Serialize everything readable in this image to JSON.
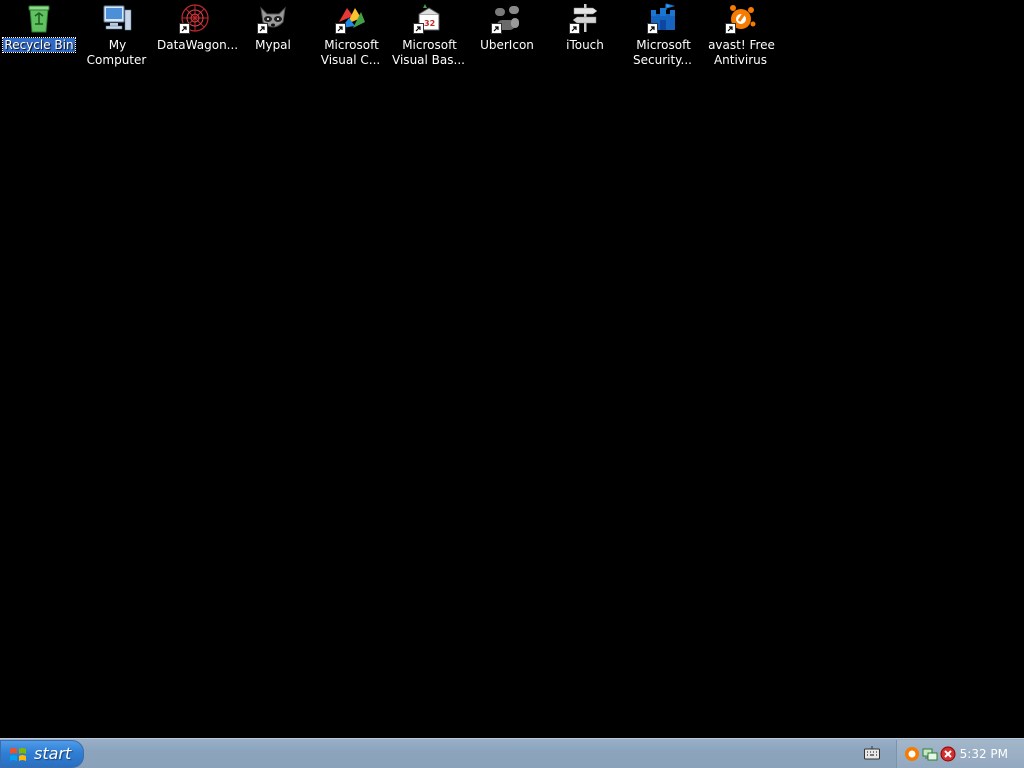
{
  "desktop": {
    "background_color": "#000000",
    "icons": [
      {
        "label": "Recycle Bin",
        "icon": "recycle-bin-icon",
        "selected": true,
        "shortcut": false
      },
      {
        "label": "My Computer",
        "icon": "my-computer-icon",
        "selected": false,
        "shortcut": false
      },
      {
        "label": "DataWagon...",
        "icon": "datawagon-icon",
        "selected": false,
        "shortcut": true
      },
      {
        "label": "Mypal",
        "icon": "mypal-icon",
        "selected": false,
        "shortcut": true
      },
      {
        "label": "Microsoft\nVisual C...",
        "icon": "visual-c-icon",
        "selected": false,
        "shortcut": true
      },
      {
        "label": "Microsoft\nVisual Bas...",
        "icon": "visual-basic-icon",
        "selected": false,
        "shortcut": true
      },
      {
        "label": "UberIcon",
        "icon": "ubericon-icon",
        "selected": false,
        "shortcut": true
      },
      {
        "label": "iTouch",
        "icon": "itouch-icon",
        "selected": false,
        "shortcut": true
      },
      {
        "label": "Microsoft\nSecurity...",
        "icon": "security-essentials-icon",
        "selected": false,
        "shortcut": true
      },
      {
        "label": "avast! Free\nAntivirus",
        "icon": "avast-icon",
        "selected": false,
        "shortcut": true
      }
    ]
  },
  "taskbar": {
    "start_label": "start",
    "clock": "5:32 PM",
    "tray_icons": [
      "keyboard-icon",
      "avast-tray-icon",
      "network-tray-icon",
      "security-alert-icon"
    ],
    "colors": {
      "start_button": "#2f7fd6",
      "taskbar": "#8ca4bd",
      "selection": "#316ac5"
    }
  }
}
